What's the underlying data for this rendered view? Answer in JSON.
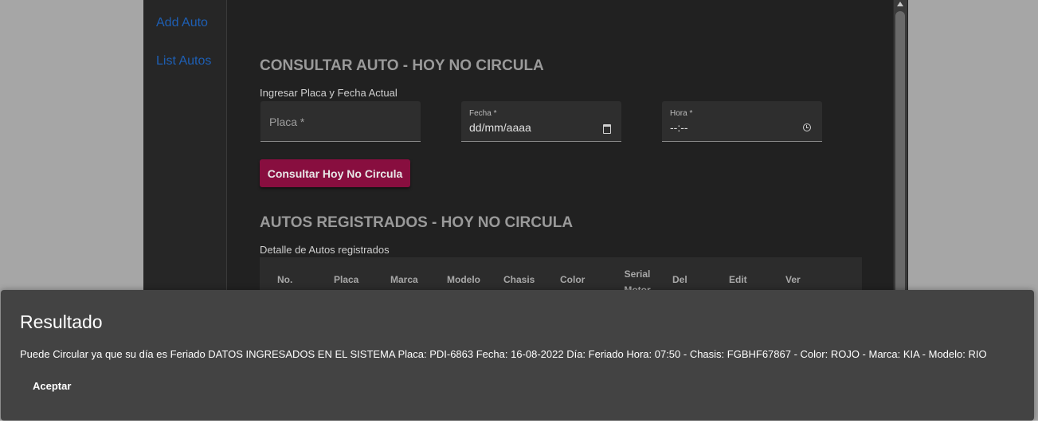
{
  "sidebar": {
    "items": [
      {
        "label": "Add Auto"
      },
      {
        "label": "List Autos"
      }
    ]
  },
  "consult": {
    "title": "CONSULTAR AUTO - HOY NO CIRCULA",
    "subtitle": "Ingresar Placa y Fecha Actual",
    "placa_placeholder": "Placa *",
    "placa_value": "",
    "fecha_label": "Fecha *",
    "fecha_value": "dd/mm/aaaa",
    "hora_label": "Hora *",
    "hora_value": "--:--",
    "button_label": "Consultar Hoy No Circula"
  },
  "registered": {
    "title": "AUTOS REGISTRADOS - HOY NO CIRCULA",
    "subtitle": "Detalle de Autos registrados",
    "columns": [
      "No.",
      "Placa",
      "Marca",
      "Modelo",
      "Chasis",
      "Color",
      "Serial Motor",
      "Del",
      "Edit",
      "Ver"
    ]
  },
  "dialog": {
    "title": "Resultado",
    "message": "Puede Circular ya que su día es Feriado DATOS INGRESADOS EN EL SISTEMA Placa: PDI-6863 Fecha: 16-08-2022 Día: Feriado Hora: 07:50 - Chasis: FGBHF67867 - Color: ROJO - Marca: KIA - Modelo: RIO",
    "accept_label": "Aceptar"
  },
  "colors": {
    "accent_button": "#880e3f",
    "link": "#1e5fb4",
    "background": "#212121",
    "dialog": "#434343"
  },
  "icons": [
    "calendar-icon",
    "clock-icon",
    "scroll-up-arrow-icon"
  ]
}
